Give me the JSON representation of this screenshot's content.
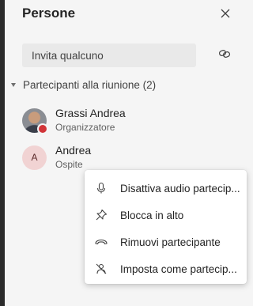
{
  "panel": {
    "title": "Persone",
    "close_icon": "close-icon",
    "invite": {
      "placeholder": "Invita qualcuno"
    },
    "share_link_icon": "link-icon",
    "section": {
      "label": "Partecipanti alla riunione (2)",
      "expanded": true
    }
  },
  "participants": [
    {
      "name": "Grassi Andrea",
      "role": "Organizzatore",
      "avatar": "photo",
      "presence_color": "#d13438"
    },
    {
      "name": "Andrea",
      "role": "Ospite",
      "initial": "A",
      "avatar_color": "#f1d3d3"
    }
  ],
  "context_menu": {
    "items": [
      {
        "label": "Disattiva audio partecip...",
        "icon": "microphone-icon"
      },
      {
        "label": "Blocca in alto",
        "icon": "pin-icon"
      },
      {
        "label": "Rimuovi partecipante",
        "icon": "hang-up-icon"
      },
      {
        "label": "Imposta come partecip...",
        "icon": "attendee-icon"
      }
    ]
  }
}
